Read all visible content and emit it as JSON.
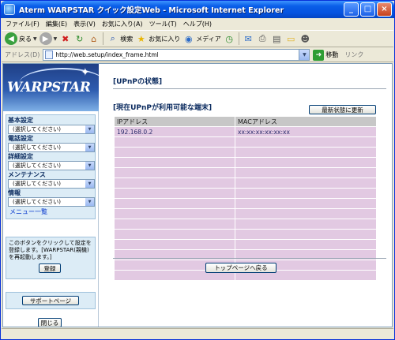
{
  "window": {
    "title": "Aterm WARPSTAR クイック設定Web - Microsoft Internet Explorer",
    "minimize_glyph": "_",
    "maximize_glyph": "□",
    "close_glyph": "×"
  },
  "menu": [
    "ファイル(F)",
    "編集(E)",
    "表示(V)",
    "お気に入り(A)",
    "ツール(T)",
    "ヘルプ(H)"
  ],
  "toolbar": {
    "back": "戻る",
    "search": "検索",
    "favorites": "お気に入り",
    "media": "メディア"
  },
  "address": {
    "label": "アドレス(D)",
    "url": "http://web.setup/index_frame.html",
    "go": "移動",
    "links": "リンク"
  },
  "logo": {
    "text": "WARPSTAR"
  },
  "nav": {
    "groups": [
      {
        "label": "基本設定",
        "value": "(選択してください)"
      },
      {
        "label": "電話設定",
        "value": "(選択してください)"
      },
      {
        "label": "詳細設定",
        "value": "(選択してください)"
      },
      {
        "label": "メンテナンス",
        "value": "(選択してください)"
      },
      {
        "label": "情報",
        "value": "(選択してください)"
      }
    ],
    "menu_list": "メニュー一覧"
  },
  "note": {
    "text": "このボタンをクリックして設定を登録します。[WARPSTAR(親機)を再起動します。]",
    "register": "登録"
  },
  "support": "サポートページ",
  "close_button": "閉じる",
  "main": {
    "page_title": "[UPnPの状態]",
    "section_title": "[現在UPnPが利用可能な端末]",
    "refresh": "最新状態に更新",
    "table": {
      "headers": [
        "IPアドレス",
        "MACアドレス"
      ],
      "rows": [
        [
          "192.168.0.2",
          "xx:xx:xx:xx:xx:xx"
        ],
        [
          "",
          ""
        ],
        [
          "",
          ""
        ],
        [
          "",
          ""
        ],
        [
          "",
          ""
        ],
        [
          "",
          ""
        ],
        [
          "",
          ""
        ],
        [
          "",
          ""
        ],
        [
          "",
          ""
        ],
        [
          "",
          ""
        ],
        [
          "",
          ""
        ],
        [
          "",
          ""
        ],
        [
          "",
          ""
        ],
        [
          "",
          ""
        ],
        [
          "",
          ""
        ]
      ]
    },
    "top_button": "トップページへ戻る"
  },
  "colors": {
    "header_row": "#c7c7c7",
    "data_row": "#e2c9e2",
    "nav_panel": "#dcecf6"
  }
}
